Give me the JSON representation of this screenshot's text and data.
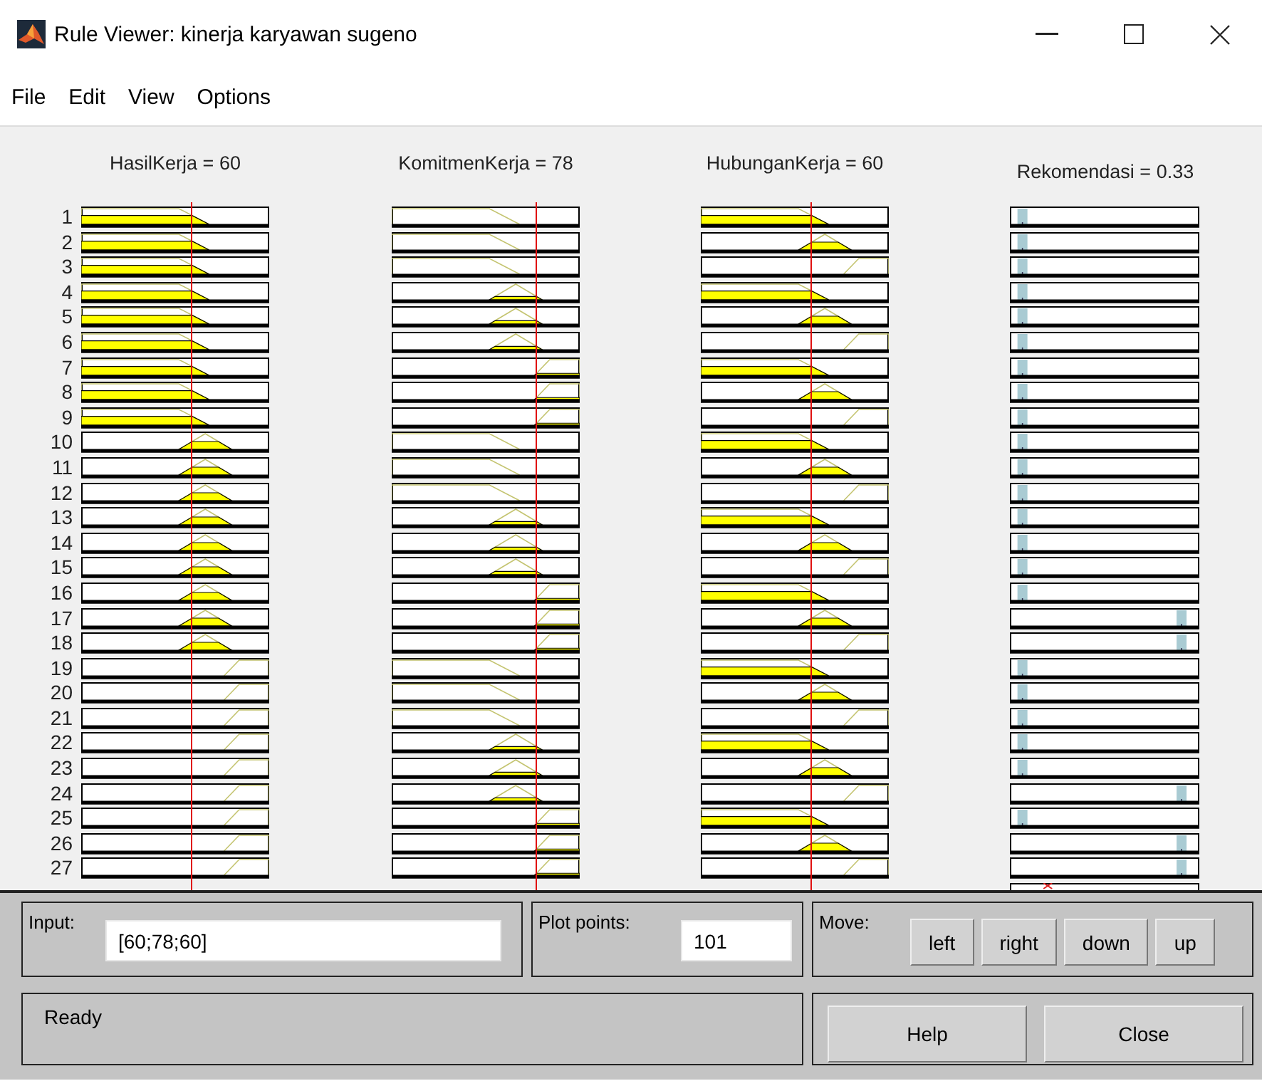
{
  "window": {
    "title": "Rule Viewer: kinerja karyawan sugeno"
  },
  "menu": [
    "File",
    "Edit",
    "View",
    "Options"
  ],
  "inputs": [
    {
      "label": "HasilKerja = 60"
    },
    {
      "label": "KomitmenKerja = 78"
    },
    {
      "label": "HubunganKerja = 60"
    }
  ],
  "output": {
    "label": "Rekomendasi = 0.33"
  },
  "rules": [
    {
      "number": "1",
      "terms": [
        {
          "kind": "low"
        },
        {
          "kind": "low"
        },
        {
          "kind": "low"
        }
      ],
      "output": {
        "kind": "low"
      }
    },
    {
      "number": "2",
      "terms": [
        {
          "kind": "low"
        },
        {
          "kind": "low"
        },
        {
          "kind": "mid"
        }
      ],
      "output": {
        "kind": "low"
      }
    },
    {
      "number": "3",
      "terms": [
        {
          "kind": "low"
        },
        {
          "kind": "low"
        },
        {
          "kind": "high"
        }
      ],
      "output": {
        "kind": "low"
      }
    },
    {
      "number": "4",
      "terms": [
        {
          "kind": "low"
        },
        {
          "kind": "mid"
        },
        {
          "kind": "low"
        }
      ],
      "output": {
        "kind": "low"
      }
    },
    {
      "number": "5",
      "terms": [
        {
          "kind": "low"
        },
        {
          "kind": "mid"
        },
        {
          "kind": "mid"
        }
      ],
      "output": {
        "kind": "low"
      }
    },
    {
      "number": "6",
      "terms": [
        {
          "kind": "low"
        },
        {
          "kind": "mid"
        },
        {
          "kind": "high"
        }
      ],
      "output": {
        "kind": "low"
      }
    },
    {
      "number": "7",
      "terms": [
        {
          "kind": "low"
        },
        {
          "kind": "high"
        },
        {
          "kind": "low"
        }
      ],
      "output": {
        "kind": "low"
      }
    },
    {
      "number": "8",
      "terms": [
        {
          "kind": "low"
        },
        {
          "kind": "high"
        },
        {
          "kind": "mid"
        }
      ],
      "output": {
        "kind": "low"
      }
    },
    {
      "number": "9",
      "terms": [
        {
          "kind": "low"
        },
        {
          "kind": "high"
        },
        {
          "kind": "high"
        }
      ],
      "output": {
        "kind": "low"
      }
    },
    {
      "number": "10",
      "terms": [
        {
          "kind": "mid"
        },
        {
          "kind": "low"
        },
        {
          "kind": "low"
        }
      ],
      "output": {
        "kind": "low"
      }
    },
    {
      "number": "11",
      "terms": [
        {
          "kind": "mid"
        },
        {
          "kind": "low"
        },
        {
          "kind": "mid"
        }
      ],
      "output": {
        "kind": "low"
      }
    },
    {
      "number": "12",
      "terms": [
        {
          "kind": "mid"
        },
        {
          "kind": "low"
        },
        {
          "kind": "high"
        }
      ],
      "output": {
        "kind": "low"
      }
    },
    {
      "number": "13",
      "terms": [
        {
          "kind": "mid"
        },
        {
          "kind": "mid"
        },
        {
          "kind": "low"
        }
      ],
      "output": {
        "kind": "low"
      }
    },
    {
      "number": "14",
      "terms": [
        {
          "kind": "mid"
        },
        {
          "kind": "mid"
        },
        {
          "kind": "mid"
        }
      ],
      "output": {
        "kind": "low"
      }
    },
    {
      "number": "15",
      "terms": [
        {
          "kind": "mid"
        },
        {
          "kind": "mid"
        },
        {
          "kind": "high"
        }
      ],
      "output": {
        "kind": "low"
      }
    },
    {
      "number": "16",
      "terms": [
        {
          "kind": "mid"
        },
        {
          "kind": "high"
        },
        {
          "kind": "low"
        }
      ],
      "output": {
        "kind": "low"
      }
    },
    {
      "number": "17",
      "terms": [
        {
          "kind": "mid"
        },
        {
          "kind": "high"
        },
        {
          "kind": "mid"
        }
      ],
      "output": {
        "kind": "high"
      }
    },
    {
      "number": "18",
      "terms": [
        {
          "kind": "mid"
        },
        {
          "kind": "high"
        },
        {
          "kind": "high"
        }
      ],
      "output": {
        "kind": "high"
      }
    },
    {
      "number": "19",
      "terms": [
        {
          "kind": "high"
        },
        {
          "kind": "low"
        },
        {
          "kind": "low"
        }
      ],
      "output": {
        "kind": "low"
      }
    },
    {
      "number": "20",
      "terms": [
        {
          "kind": "high"
        },
        {
          "kind": "low"
        },
        {
          "kind": "mid"
        }
      ],
      "output": {
        "kind": "low"
      }
    },
    {
      "number": "21",
      "terms": [
        {
          "kind": "high"
        },
        {
          "kind": "low"
        },
        {
          "kind": "high"
        }
      ],
      "output": {
        "kind": "low"
      }
    },
    {
      "number": "22",
      "terms": [
        {
          "kind": "high"
        },
        {
          "kind": "mid"
        },
        {
          "kind": "low"
        }
      ],
      "output": {
        "kind": "low"
      }
    },
    {
      "number": "23",
      "terms": [
        {
          "kind": "high"
        },
        {
          "kind": "mid"
        },
        {
          "kind": "mid"
        }
      ],
      "output": {
        "kind": "low"
      }
    },
    {
      "number": "24",
      "terms": [
        {
          "kind": "high"
        },
        {
          "kind": "mid"
        },
        {
          "kind": "high"
        }
      ],
      "output": {
        "kind": "high"
      }
    },
    {
      "number": "25",
      "terms": [
        {
          "kind": "high"
        },
        {
          "kind": "high"
        },
        {
          "kind": "low"
        }
      ],
      "output": {
        "kind": "low"
      }
    },
    {
      "number": "26",
      "terms": [
        {
          "kind": "high"
        },
        {
          "kind": "high"
        },
        {
          "kind": "mid"
        }
      ],
      "output": {
        "kind": "high"
      }
    },
    {
      "number": "27",
      "terms": [
        {
          "kind": "high"
        },
        {
          "kind": "high"
        },
        {
          "kind": "high"
        }
      ],
      "output": {
        "kind": "high"
      }
    }
  ],
  "input_field": {
    "label": "Input:",
    "value": "[60;78;60]"
  },
  "plot_points": {
    "label": "Plot points:",
    "value": "101"
  },
  "move": {
    "label": "Move:",
    "buttons": [
      "left",
      "right",
      "down",
      "up"
    ]
  },
  "status": "Ready",
  "buttons": [
    "Help",
    "Close"
  ]
}
